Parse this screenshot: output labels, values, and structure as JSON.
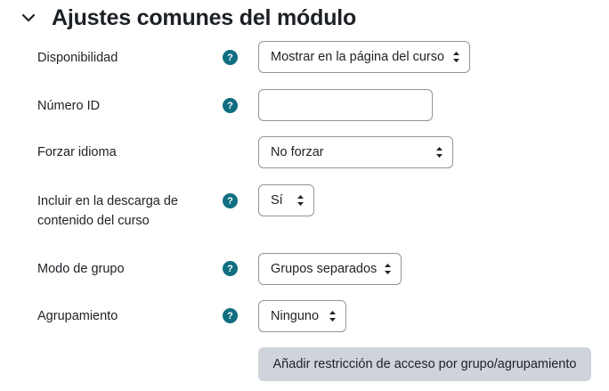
{
  "section": {
    "title": "Ajustes comunes del módulo"
  },
  "fields": {
    "availability": {
      "label": "Disponibilidad",
      "value": "Mostrar en la página del curso"
    },
    "idnumber": {
      "label": "Número ID",
      "value": ""
    },
    "force_language": {
      "label": "Forzar idioma",
      "value": "No forzar"
    },
    "download_content": {
      "label": "Incluir en la descarga de contenido del curso",
      "value": "Sí"
    },
    "group_mode": {
      "label": "Modo de grupo",
      "value": "Grupos separados"
    },
    "grouping": {
      "label": "Agrupamiento",
      "value": "Ninguno"
    }
  },
  "buttons": {
    "add_restriction": "Añadir restricción de acceso por grupo/agrupamiento"
  },
  "help_icon_glyph": "?",
  "colors": {
    "help_icon": "#0f6e80",
    "button_bg": "#ced4da",
    "border": "#8f959e",
    "text": "#1d2125"
  }
}
